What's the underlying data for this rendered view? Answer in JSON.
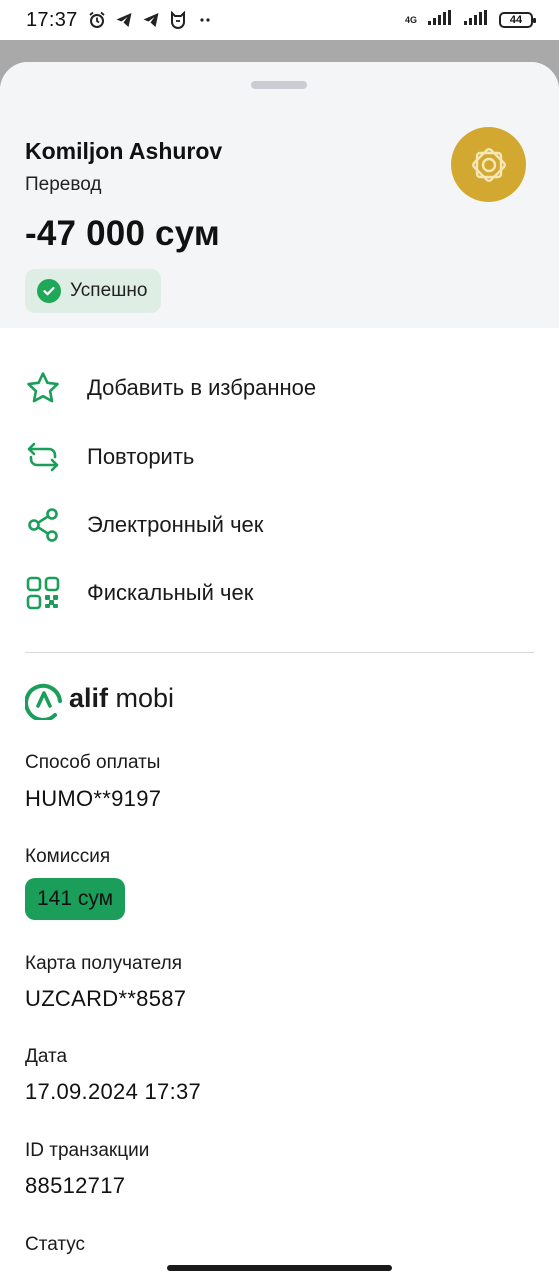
{
  "statusbar": {
    "time": "17:37",
    "network": "4G",
    "battery": "44",
    "icons": [
      "alarm-icon",
      "telegram-icon",
      "telegram-icon",
      "mi-icon",
      "more-dots-icon",
      "signal-icon",
      "signal-icon",
      "battery-icon"
    ]
  },
  "header": {
    "name": "Komiljon Ashurov",
    "type": "Перевод",
    "amount": "-47 000 сум",
    "status": "Успешно",
    "status_color": "#1fa857",
    "logo_color": "#d3a831"
  },
  "actions": [
    {
      "label": "Добавить в избранное",
      "icon": "star-icon"
    },
    {
      "label": "Повторить",
      "icon": "repeat-icon"
    },
    {
      "label": "Электронный чек",
      "icon": "share-icon"
    },
    {
      "label": "Фискальный чек",
      "icon": "qr-code-icon"
    }
  ],
  "brand": {
    "name_bold": "alif",
    "name_light": "mobi",
    "color": "#1a9e59"
  },
  "details": {
    "payment_method_label": "Способ оплаты",
    "payment_method_value": "HUMO**9197",
    "fee_label": "Комиссия",
    "fee_value": "141 сум",
    "recipient_card_label": "Карта получателя",
    "recipient_card_value": "UZCARD**8587",
    "date_label": "Дата",
    "date_value": "17.09.2024 17:37",
    "transaction_id_label": "ID транзакции",
    "transaction_id_value": "88512717",
    "status_label": "Статус"
  }
}
